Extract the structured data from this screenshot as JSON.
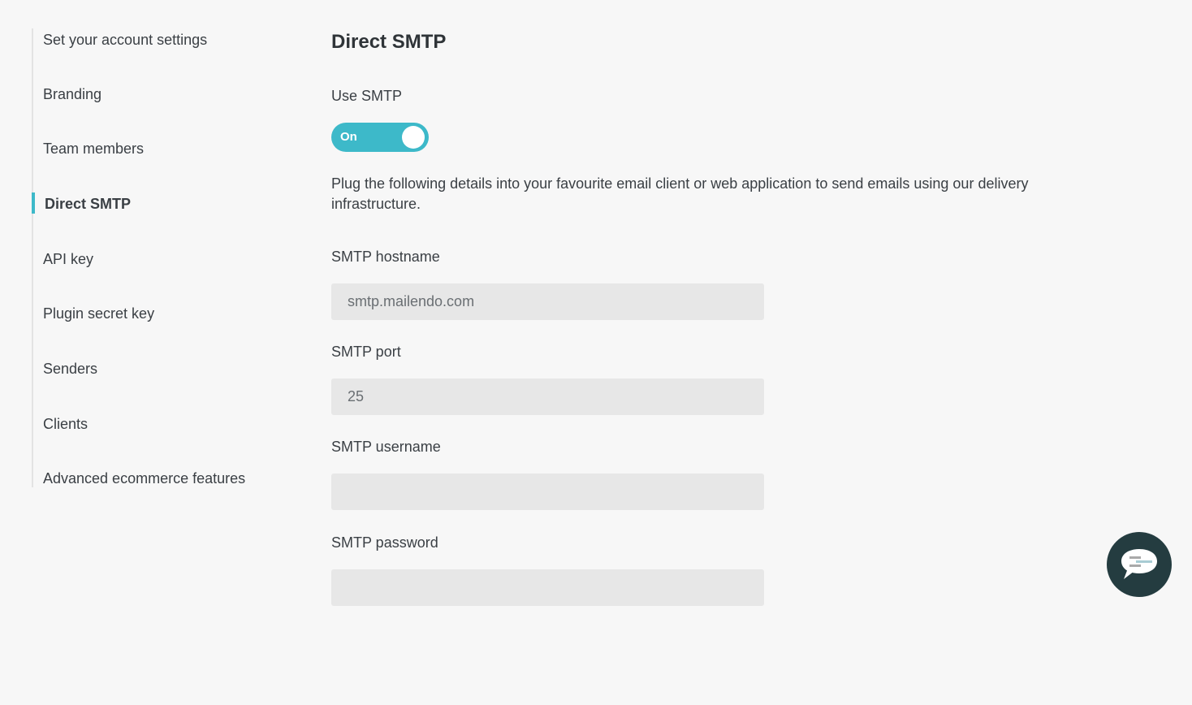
{
  "sidebar": {
    "items": [
      {
        "label": "Set your account settings",
        "active": false
      },
      {
        "label": "Branding",
        "active": false
      },
      {
        "label": "Team members",
        "active": false
      },
      {
        "label": "Direct SMTP",
        "active": true
      },
      {
        "label": "API key",
        "active": false
      },
      {
        "label": "Plugin secret key",
        "active": false
      },
      {
        "label": "Senders",
        "active": false
      },
      {
        "label": "Clients",
        "active": false
      },
      {
        "label": "Advanced ecommerce features",
        "active": false
      }
    ]
  },
  "main": {
    "title": "Direct SMTP",
    "use_smtp": {
      "label": "Use SMTP",
      "toggle_state": "On"
    },
    "description": "Plug the following details into your favourite email client or web application to send emails using our delivery infrastructure.",
    "fields": {
      "hostname": {
        "label": "SMTP hostname",
        "value": "smtp.mailendo.com"
      },
      "port": {
        "label": "SMTP port",
        "value": "25"
      },
      "username": {
        "label": "SMTP username",
        "value": ""
      },
      "password": {
        "label": "SMTP password",
        "value": ""
      }
    }
  },
  "colors": {
    "accent": "#3db9c9",
    "chat_button": "#243c40",
    "background": "#f7f7f7",
    "field_background": "#e7e7e7"
  },
  "chat": {
    "icon": "chat-bubble-icon"
  }
}
